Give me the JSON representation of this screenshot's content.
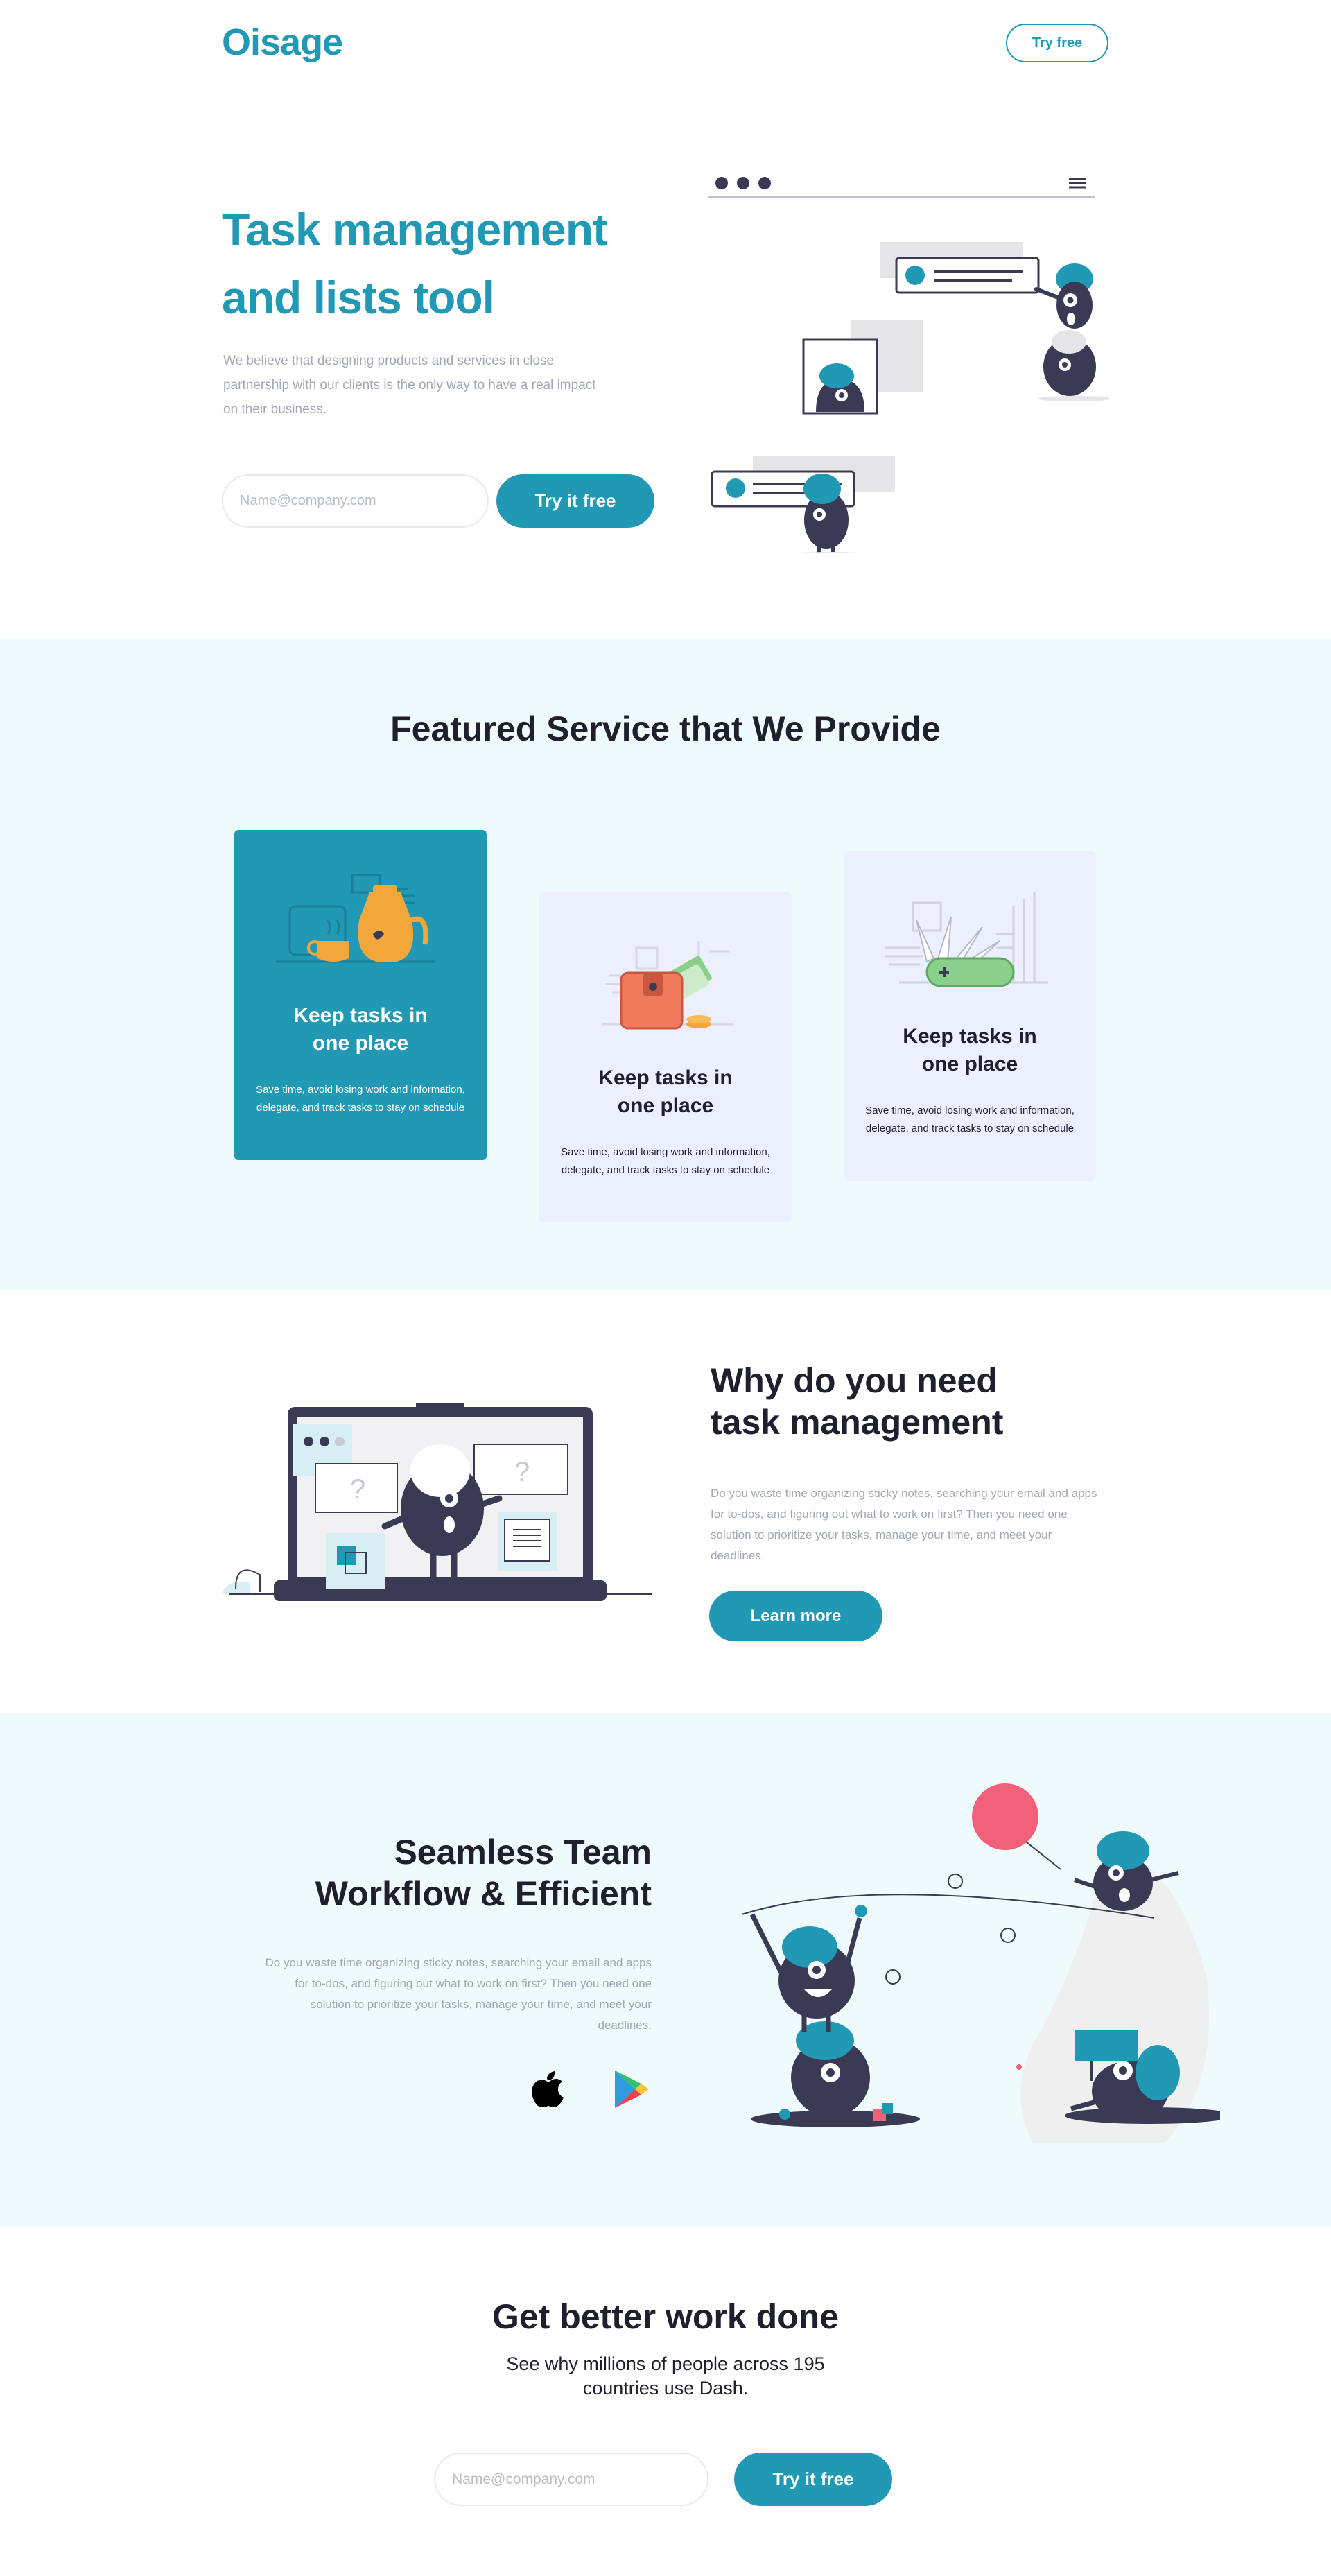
{
  "header": {
    "logo": "Oisage",
    "try_free_label": "Try free"
  },
  "hero": {
    "title_line1": "Task management",
    "title_line2": "and lists tool",
    "description": "We believe that designing products and services in close partnership with our clients is the only way to have a real impact on their business.",
    "email_placeholder": "Name@company.com",
    "cta_label": "Try it free"
  },
  "features": {
    "heading": "Featured Service that We Provide",
    "cards": [
      {
        "title_line1": "Keep tasks in",
        "title_line2": "one place",
        "text": "Save time, avoid losing work and information, delegate, and track tasks to stay on schedule",
        "icon": "teapot-icon"
      },
      {
        "title_line1": "Keep tasks in",
        "title_line2": "one place",
        "text": "Save time, avoid losing work and information, delegate, and track tasks to stay on schedule",
        "icon": "wallet-icon"
      },
      {
        "title_line1": "Keep tasks in",
        "title_line2": "one place",
        "text": "Save time, avoid losing work and information, delegate, and track tasks to stay on schedule",
        "icon": "swiss-knife-icon"
      }
    ]
  },
  "why": {
    "title_line1": "Why do you need",
    "title_line2": "task management",
    "text": "Do you waste time organizing sticky notes, searching your email and apps for to-dos, and figuring out what to work on first? Then you need one solution to prioritize your tasks, manage your time, and meet your deadlines.",
    "cta_label": "Learn more"
  },
  "workflow": {
    "title_line1": "Seamless Team",
    "title_line2": "Workflow & Efficient",
    "text": "Do you waste time organizing sticky notes, searching your email and apps for to-dos, and figuring out what to work on first? Then you need one solution to prioritize your tasks, manage your time, and meet your deadlines.",
    "apple_icon": "apple-icon",
    "play_icon": "google-play-icon"
  },
  "footer_cta": {
    "heading": "Get better work done",
    "subheading_line1": "See why millions of people across 195",
    "subheading_line2": "countries use Dash.",
    "email_placeholder": "Name@company.com",
    "cta_label": "Try it free"
  },
  "colors": {
    "accent": "#2199b5",
    "dark": "#3a3a55",
    "light_bg": "#eefafb",
    "card_bg": "#ebefff",
    "pink": "#f2607a"
  }
}
